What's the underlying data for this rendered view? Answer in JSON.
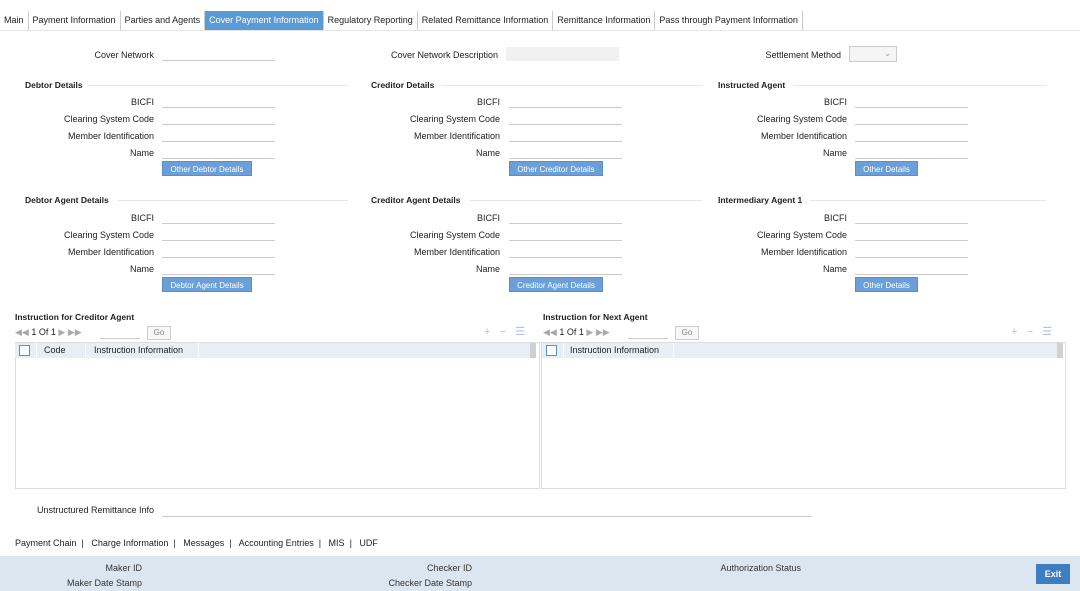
{
  "tabs": [
    "Main",
    "Payment Information",
    "Parties and Agents",
    "Cover Payment Information",
    "Regulatory Reporting",
    "Related Remittance Information",
    "Remittance Information",
    "Pass through Payment Information"
  ],
  "active_tab": "Cover Payment Information",
  "top": {
    "cover_network": "Cover Network",
    "cover_network_description": "Cover Network Description",
    "settlement_method": "Settlement Method"
  },
  "sections": {
    "debtor": "Debtor Details",
    "creditor": "Creditor Details",
    "instructed_agent": "Instructed Agent",
    "debtor_agent": "Debtor Agent Details",
    "creditor_agent": "Creditor Agent Details",
    "intermediary_agent": "Intermediary Agent 1"
  },
  "fields": {
    "bicfi": "BICFI",
    "clearing": "Clearing System Code",
    "member": "Member Identification",
    "name": "Name"
  },
  "buttons": {
    "other_debtor": "Other Debtor Details",
    "other_creditor": "Other Creditor Details",
    "other_details": "Other Details",
    "debtor_agent": "Debtor Agent Details",
    "creditor_agent": "Creditor Agent Details"
  },
  "grids": {
    "creditor_agent_title": "Instruction for Creditor Agent",
    "next_agent_title": "Instruction for Next Agent",
    "pager": "1 Of 1",
    "go": "Go",
    "col_code": "Code",
    "col_info": "Instruction Information"
  },
  "unstructured": "Unstructured Remittance Info",
  "bottom_nav": [
    "Payment Chain",
    "Charge Information",
    "Messages",
    "Accounting Entries",
    "MIS",
    "UDF"
  ],
  "footer": {
    "maker_id": "Maker ID",
    "maker_date": "Maker Date Stamp",
    "checker_id": "Checker ID",
    "checker_date": "Checker Date Stamp",
    "auth_status": "Authorization Status",
    "exit": "Exit"
  },
  "colors": {
    "accent": "#5b9bd5",
    "footer": "#dce6f0",
    "exit": "#3c7ec0"
  }
}
